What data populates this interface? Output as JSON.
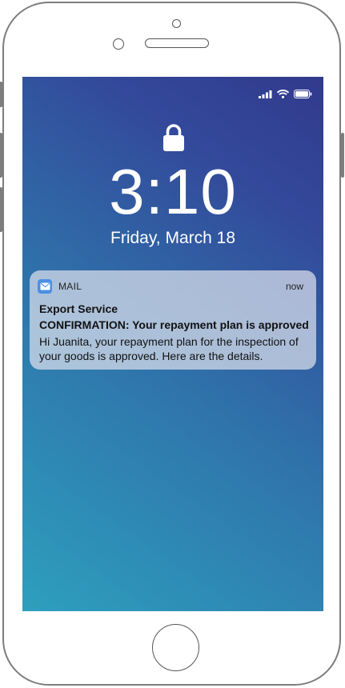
{
  "status_bar": {
    "signal_icon": "cellular-signal-icon",
    "wifi_icon": "wifi-icon",
    "battery_icon": "battery-icon"
  },
  "lock_screen": {
    "lock_icon": "lock-icon",
    "time": "3:10",
    "date": "Friday, March 18"
  },
  "notification": {
    "app_icon": "mail-icon",
    "app_name": "MAIL",
    "time": "now",
    "sender": "Export Service",
    "subject": "CONFIRMATION: Your repayment plan is approved",
    "body": "Hi Juanita, your repayment plan for the inspection of your goods is approved. Here are the details."
  },
  "colors": {
    "gradient_top": "#323a8c",
    "gradient_bottom": "#2e9fbd",
    "app_icon": "#4a90e2"
  }
}
